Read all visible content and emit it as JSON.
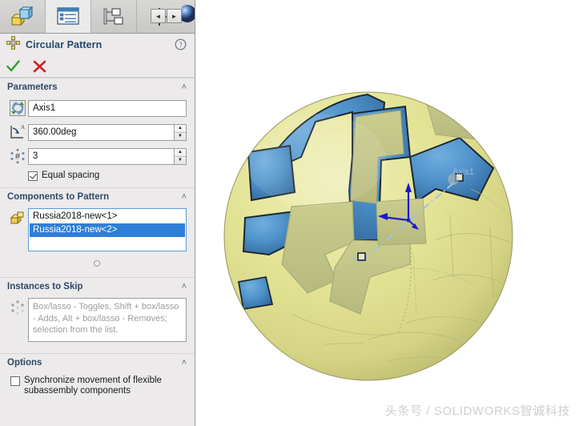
{
  "tabs": [
    {
      "name": "features-manager-tab",
      "icon": "yellow-part-block-icon",
      "active": false
    },
    {
      "name": "property-manager-tab",
      "icon": "property-list-icon",
      "active": true
    },
    {
      "name": "configuration-manager-tab",
      "icon": "configuration-tree-icon",
      "active": false
    },
    {
      "name": "dimxpert-manager-tab",
      "icon": "crosshair-target-icon",
      "active": false
    }
  ],
  "tab_nav": {
    "prev": "◄",
    "next": "►"
  },
  "property_manager": {
    "title": "Circular Pattern",
    "icon": "circular-pattern-icon",
    "help_icon": "question-mark-icon",
    "accept_icon": "green-check-icon",
    "cancel_icon": "red-x-icon"
  },
  "sections": {
    "parameters": {
      "title": "Parameters",
      "collapse_chevron": "˄",
      "axis": {
        "icon": "rotation-axis-icon",
        "value": "Axis1",
        "placeholder": ""
      },
      "angle": {
        "icon": "angle-dimension-icon",
        "value": "360.00deg",
        "spin_up": "▲",
        "spin_down": "▼"
      },
      "instances": {
        "icon": "number-of-instances-icon",
        "value": "3",
        "spin_up": "▲",
        "spin_down": "▼"
      },
      "equal_spacing": {
        "label": "Equal spacing",
        "checked": true
      }
    },
    "components_to_pattern": {
      "title": "Components to Pattern",
      "collapse_chevron": "˄",
      "icon": "components-selection-icon",
      "items": [
        {
          "label": "Russia2018-new<1>",
          "selected": false
        },
        {
          "label": "Russia2018-new<2>",
          "selected": true
        }
      ]
    },
    "instances_to_skip": {
      "title": "Instances to Skip",
      "collapse_chevron": "˄",
      "icon": "skip-instances-icon",
      "hint": "Box/lasso - Toggles, Shift + box/lasso - Adds, Alt + box/lasso - Removes; selection from the list."
    },
    "options": {
      "title": "Options",
      "collapse_chevron": "˄",
      "sync_flexible": {
        "label": "Synchronize movement of flexible subassembly components",
        "checked": false
      }
    }
  },
  "viewport": {
    "axis_label": "Axis1",
    "watermark": "头条号 / SOLIDWORKS智诚科技",
    "model_name": "Russia2018-new soccer ball",
    "colors": {
      "ball_yellow": "#e2e291",
      "ball_blue": "#4a90c8",
      "outline": "#1a2430",
      "axis_blue": "#1a1acc",
      "centerline": "#9fc4e0"
    }
  }
}
